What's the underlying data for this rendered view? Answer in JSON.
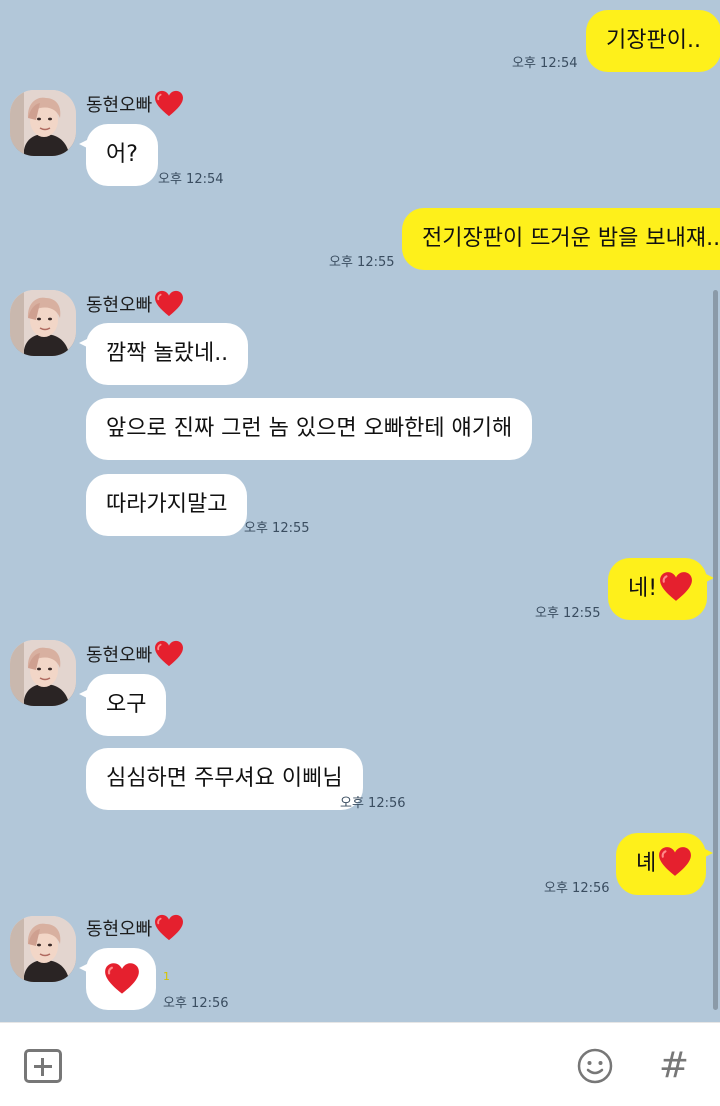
{
  "contact_name": "동현오빠",
  "messages": [
    {
      "side": "out",
      "text": "기장판이..",
      "time": "오후 12:54"
    },
    {
      "side": "in",
      "text": "어?",
      "time": "오후 12:54"
    },
    {
      "side": "out",
      "text": "전기장판이 뜨거운 밤을 보내쟤..",
      "time": "오후 12:55"
    },
    {
      "side": "in",
      "text": "깜짝 놀랐네.."
    },
    {
      "side": "in",
      "text": "앞으로 진짜 그런 놈 있으면 오빠한테 얘기해"
    },
    {
      "side": "in",
      "text": "따라가지말고",
      "time": "오후 12:55"
    },
    {
      "side": "out",
      "text": "네!",
      "time": "오후 12:55"
    },
    {
      "side": "in",
      "text": "오구"
    },
    {
      "side": "in",
      "text": "심심하면 주무셔요 이삐님",
      "time": "오후 12:56"
    },
    {
      "side": "out",
      "text": "녜",
      "time": "오후 12:56"
    },
    {
      "side": "in",
      "text": "",
      "time": "오후 12:56"
    }
  ],
  "unread_marker": "1",
  "bottom_bar": {
    "plus_icon": "plus-square-icon",
    "emoji_icon": "smiley-icon",
    "hash_label": "#"
  },
  "colors": {
    "background": "#b2c7d9",
    "outgoing_bubble": "#fef01b",
    "incoming_bubble": "#ffffff",
    "heart": "#e5202e"
  }
}
